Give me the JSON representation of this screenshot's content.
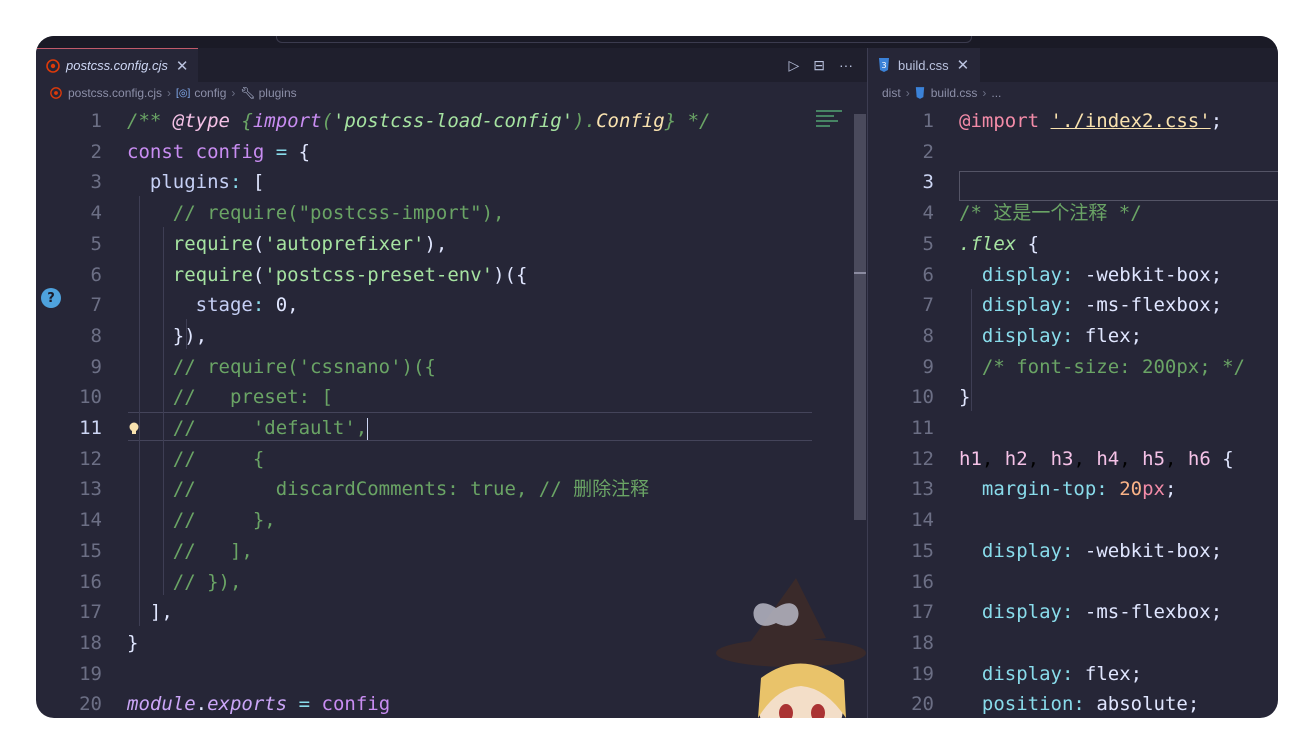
{
  "left_pane": {
    "tab": {
      "title": "postcss.config.cjs",
      "close": "✕",
      "icon": "postcss-icon"
    },
    "actions": {
      "run": "▷",
      "split": "⊟",
      "more": "···"
    },
    "breadcrumb": {
      "file": "postcss.config.cjs",
      "symbol1": "config",
      "symbol2": "plugins"
    },
    "active_line": 11
  },
  "right_pane": {
    "tab": {
      "title": "build.css",
      "close": "✕",
      "icon": "css-icon"
    },
    "breadcrumb": {
      "folder": "dist",
      "file": "build.css",
      "more": "..."
    },
    "active_line": 3
  },
  "left_code": [
    {
      "n": "1",
      "t": "/** @type {import('postcss-load-config').Config} */"
    },
    {
      "n": "2",
      "t": "const config = {"
    },
    {
      "n": "3",
      "t": "  plugins: ["
    },
    {
      "n": "4",
      "t": "    // require(\"postcss-import\"),"
    },
    {
      "n": "5",
      "t": "    require('autoprefixer'),"
    },
    {
      "n": "6",
      "t": "    require('postcss-preset-env')({"
    },
    {
      "n": "7",
      "t": "      stage: 0,"
    },
    {
      "n": "8",
      "t": "    }),"
    },
    {
      "n": "9",
      "t": "    // require('cssnano')({"
    },
    {
      "n": "10",
      "t": "    //   preset: ["
    },
    {
      "n": "11",
      "t": "    //     'default',"
    },
    {
      "n": "12",
      "t": "    //     {"
    },
    {
      "n": "13",
      "t": "    //       discardComments: true, // 删除注释"
    },
    {
      "n": "14",
      "t": "    //     },"
    },
    {
      "n": "15",
      "t": "    //   ],"
    },
    {
      "n": "16",
      "t": "    // }),"
    },
    {
      "n": "17",
      "t": "  ],"
    },
    {
      "n": "18",
      "t": "}"
    },
    {
      "n": "19",
      "t": ""
    },
    {
      "n": "20",
      "t": "module.exports = config"
    }
  ],
  "right_code": [
    {
      "n": "1",
      "t": "@import './index2.css';"
    },
    {
      "n": "2",
      "t": ""
    },
    {
      "n": "3",
      "t": ""
    },
    {
      "n": "4",
      "t": "/* 这是一个注释 */"
    },
    {
      "n": "5",
      "t": ".flex {"
    },
    {
      "n": "6",
      "t": "  display: -webkit-box;"
    },
    {
      "n": "7",
      "t": "  display: -ms-flexbox;"
    },
    {
      "n": "8",
      "t": "  display: flex;"
    },
    {
      "n": "9",
      "t": "  /* font-size: 200px; */"
    },
    {
      "n": "10",
      "t": "}"
    },
    {
      "n": "11",
      "t": ""
    },
    {
      "n": "12",
      "t": "h1, h2, h3, h4, h5, h6 {"
    },
    {
      "n": "13",
      "t": "  margin-top: 20px;"
    },
    {
      "n": "14",
      "t": ""
    },
    {
      "n": "15",
      "t": "  display: -webkit-box;"
    },
    {
      "n": "16",
      "t": ""
    },
    {
      "n": "17",
      "t": "  display: -ms-flexbox;"
    },
    {
      "n": "18",
      "t": ""
    },
    {
      "n": "19",
      "t": "  display: flex;"
    },
    {
      "n": "20",
      "t": "  position: absolute;"
    }
  ],
  "icons": {
    "help": "?",
    "lightbulb": "lightbulb-icon"
  }
}
